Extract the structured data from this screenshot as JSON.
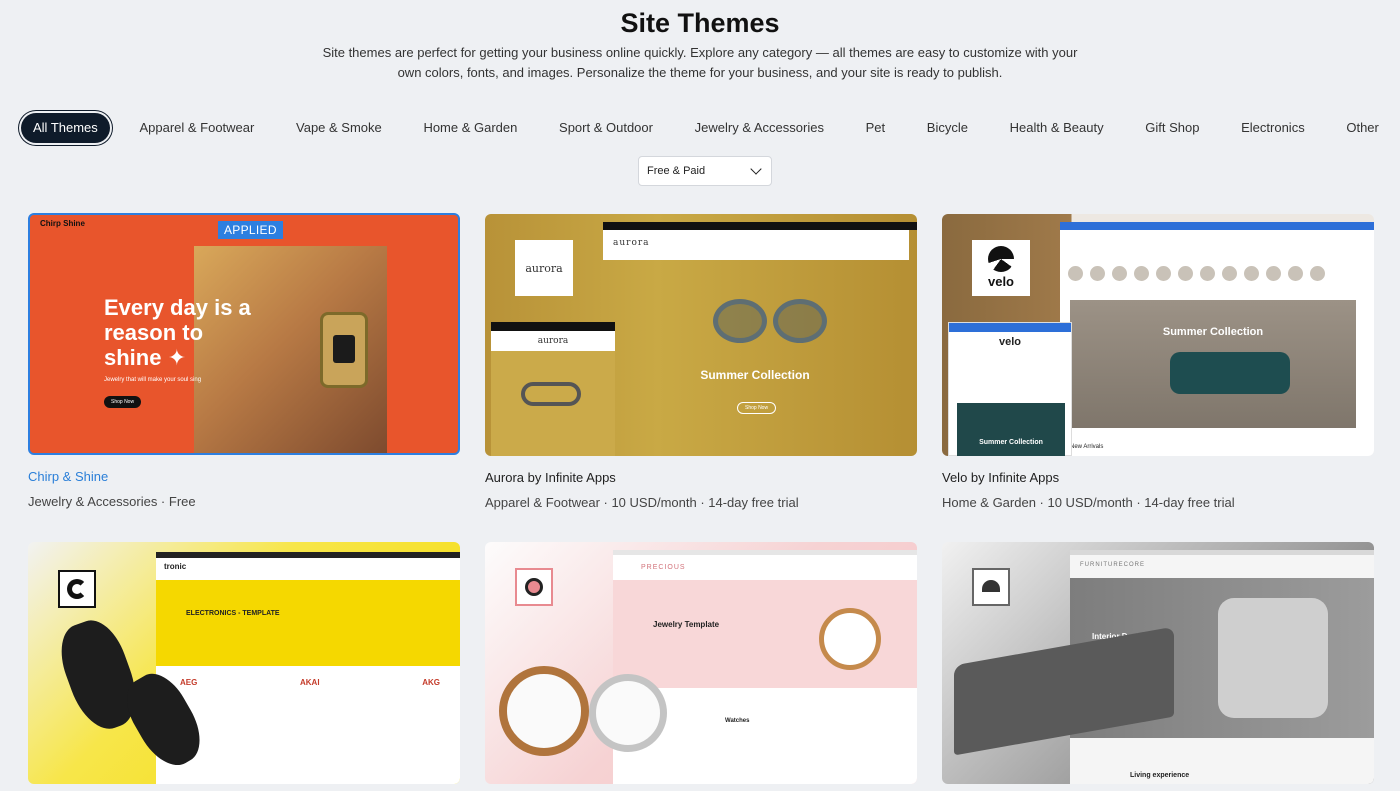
{
  "header": {
    "title": "Site Themes",
    "description": "Site themes are perfect for getting your business online quickly. Explore any category — all themes are easy to customize with your own colors, fonts, and images. Personalize the theme for your business, and your site is ready to publish."
  },
  "categories": [
    {
      "label": "All Themes",
      "active": true
    },
    {
      "label": "Apparel & Footwear"
    },
    {
      "label": "Vape & Smoke"
    },
    {
      "label": "Home & Garden"
    },
    {
      "label": "Sport & Outdoor"
    },
    {
      "label": "Jewelry & Accessories"
    },
    {
      "label": "Pet"
    },
    {
      "label": "Bicycle"
    },
    {
      "label": "Health & Beauty"
    },
    {
      "label": "Gift Shop"
    },
    {
      "label": "Electronics"
    },
    {
      "label": "Other"
    }
  ],
  "filter": {
    "selected": "Free & Paid"
  },
  "themes": [
    {
      "name": "Chirp & Shine",
      "meta": "Jewelry & Accessories · Free",
      "badge": "APPLIED",
      "preview": {
        "logo": "Chirp Shine",
        "headline": "Every day is a reason to shine ✦",
        "sub": "Jewelry that will make your soul sing",
        "button": "Shop Now"
      }
    },
    {
      "name": "Aurora by Infinite Apps",
      "meta": "Apparel & Footwear · 10 USD/month · 14-day free trial",
      "preview": {
        "logo": "aurora",
        "mobile_logo": "aurora",
        "headline": "Summer Collection",
        "button": "Shop Now"
      }
    },
    {
      "name": "Velo by Infinite Apps",
      "meta": "Home & Garden · 10 USD/month · 14-day free trial",
      "preview": {
        "logo": "velo",
        "headline": "Summer Collection",
        "section": "New Arrivals",
        "mobile_hero": "Summer Collection"
      }
    },
    {
      "name": "",
      "meta": "",
      "preview": {
        "brand": "tronic",
        "headline": "ELECTRONICS - TEMPLATE",
        "brands": [
          "AEG",
          "AKAI",
          "AKG"
        ]
      }
    },
    {
      "name": "",
      "meta": "",
      "preview": {
        "brand": "PRECIOUS",
        "headline": "Jewelry Template",
        "section": "Watches"
      }
    },
    {
      "name": "",
      "meta": "",
      "preview": {
        "brand": "FURNITURECORE",
        "headline": "Interior Design",
        "section": "Living experience"
      }
    }
  ]
}
